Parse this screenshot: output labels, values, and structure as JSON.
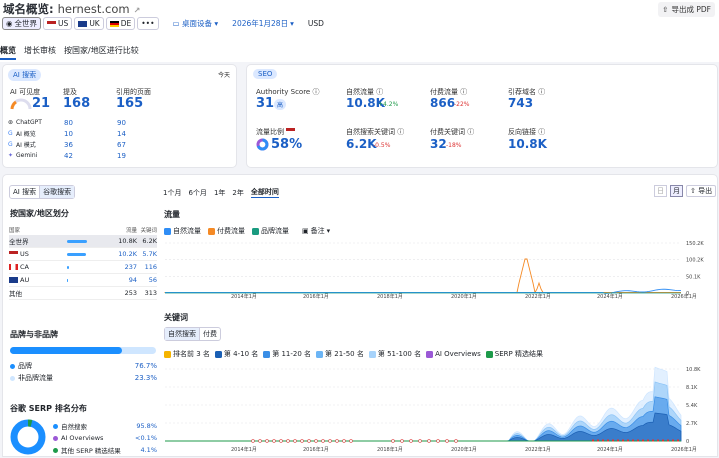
{
  "header": {
    "title": "域名概览:",
    "domain": "hernest.com",
    "export": "导出成 PDF"
  },
  "filters": {
    "global": "全世界",
    "us": "US",
    "uk": "UK",
    "de": "DE",
    "more": "•••",
    "device": "桌面设备",
    "date": "2026年1月28日",
    "currency": "USD"
  },
  "tabs": [
    "概览",
    "增长审核",
    "按国家/地区进行比较"
  ],
  "ai": {
    "badge": "AI 搜索",
    "today": "今天",
    "visibility_label": "AI 可见度",
    "visibility": "21",
    "mentions_label": "提及",
    "mentions": "168",
    "cited_label": "引用的页面",
    "cited": "165",
    "rows": [
      {
        "name": "ChatGPT",
        "a": "80",
        "b": "90"
      },
      {
        "name": "AI 概览",
        "a": "10",
        "b": "14"
      },
      {
        "name": "AI 模式",
        "a": "36",
        "b": "67"
      },
      {
        "name": "Gemini",
        "a": "42",
        "b": "19"
      }
    ]
  },
  "seo": {
    "badge": "SEO",
    "authority_label": "Authority Score",
    "authority": "31",
    "authority_tag": "高",
    "organic_label": "自然流量",
    "organic": "10.8K",
    "organic_delta": "+4.2%",
    "paid_label": "付费流量",
    "paid": "866",
    "paid_delta": "-22%",
    "refdomains_label": "引荐域名",
    "refdomains": "743",
    "share_label": "流量比例",
    "share": "58%",
    "orgkw_label": "自然搜索关键词",
    "orgkw": "6.2K",
    "orgkw_delta": "-0.5%",
    "paidkw_label": "付费关键词",
    "paidkw": "32",
    "paidkw_delta": "-18%",
    "backlinks_label": "反向链接",
    "backlinks": "10.8K"
  },
  "left": {
    "seg_ai": "AI 搜索",
    "seg_google": "谷歌搜索",
    "dist_title": "按国家/地区划分",
    "col_country": "国家",
    "col_traffic": "流量",
    "col_kw": "关键词",
    "countries": [
      {
        "name": "全世界",
        "traffic": "10.8K",
        "kw": "6.2K",
        "bar": 1.0
      },
      {
        "name": "US",
        "traffic": "10.2K",
        "kw": "5.7K",
        "bar": 0.94
      },
      {
        "name": "CA",
        "traffic": "237",
        "kw": "116",
        "bar": 0.1
      },
      {
        "name": "AU",
        "traffic": "94",
        "kw": "56",
        "bar": 0.05
      },
      {
        "name": "其他",
        "traffic": "253",
        "kw": "313",
        "bar": 0
      }
    ],
    "brand_title": "品牌与非品牌",
    "brand_label": "品牌",
    "brand_pct": "76.7%",
    "nonbrand_label": "非品牌流量",
    "nonbrand_pct": "23.3%",
    "brand_share": 0.767,
    "serp_title": "谷歌 SERP 排名分布",
    "serp": [
      {
        "label": "自然搜索",
        "pct": "95.8%",
        "color": "#1b8fff"
      },
      {
        "label": "AI Overviews",
        "pct": "<0.1%",
        "color": "#9b59d6"
      },
      {
        "label": "其他 SERP 精选结果",
        "pct": "4.1%",
        "color": "#1e9a4a"
      }
    ]
  },
  "right": {
    "periods": [
      "1个月",
      "6个月",
      "1年",
      "2年",
      "全部时间"
    ],
    "export": "导出",
    "traffic_title": "流量",
    "traffic_legend": [
      {
        "label": "自然流量",
        "color": "#2f8df5"
      },
      {
        "label": "付费流量",
        "color": "#f58a25"
      },
      {
        "label": "品牌流量",
        "color": "#1a9b80"
      }
    ],
    "note": "备注",
    "y1": [
      "150.2K",
      "100.2K",
      "50.1K",
      "0"
    ],
    "x": [
      "2014年1月",
      "2016年1月",
      "2018年1月",
      "2020年1月",
      "2022年1月",
      "2024年1月",
      "2026年1月"
    ],
    "kw_title": "关键词",
    "kw_seg_org": "自然搜索",
    "kw_seg_paid": "付费",
    "kw_legend": [
      {
        "label": "排名前 3 名",
        "color": "#f5b400"
      },
      {
        "label": "第 4-10 名",
        "color": "#1a5fb4"
      },
      {
        "label": "第 11-20 名",
        "color": "#3a8ee6"
      },
      {
        "label": "第 21-50 名",
        "color": "#6cb5f5"
      },
      {
        "label": "第 51-100 名",
        "color": "#a7d3fb"
      },
      {
        "label": "AI Overviews",
        "color": "#9b59d6"
      },
      {
        "label": "SERP 精选结果",
        "color": "#1e9a4a"
      }
    ],
    "y2": [
      "10.8K",
      "8.1K",
      "5.4K",
      "2.7K",
      "0"
    ]
  },
  "colors": {
    "accent": "#1b5fc5",
    "organic": "#2f8df5",
    "paid": "#f58a25",
    "branded": "#1a9b80"
  }
}
